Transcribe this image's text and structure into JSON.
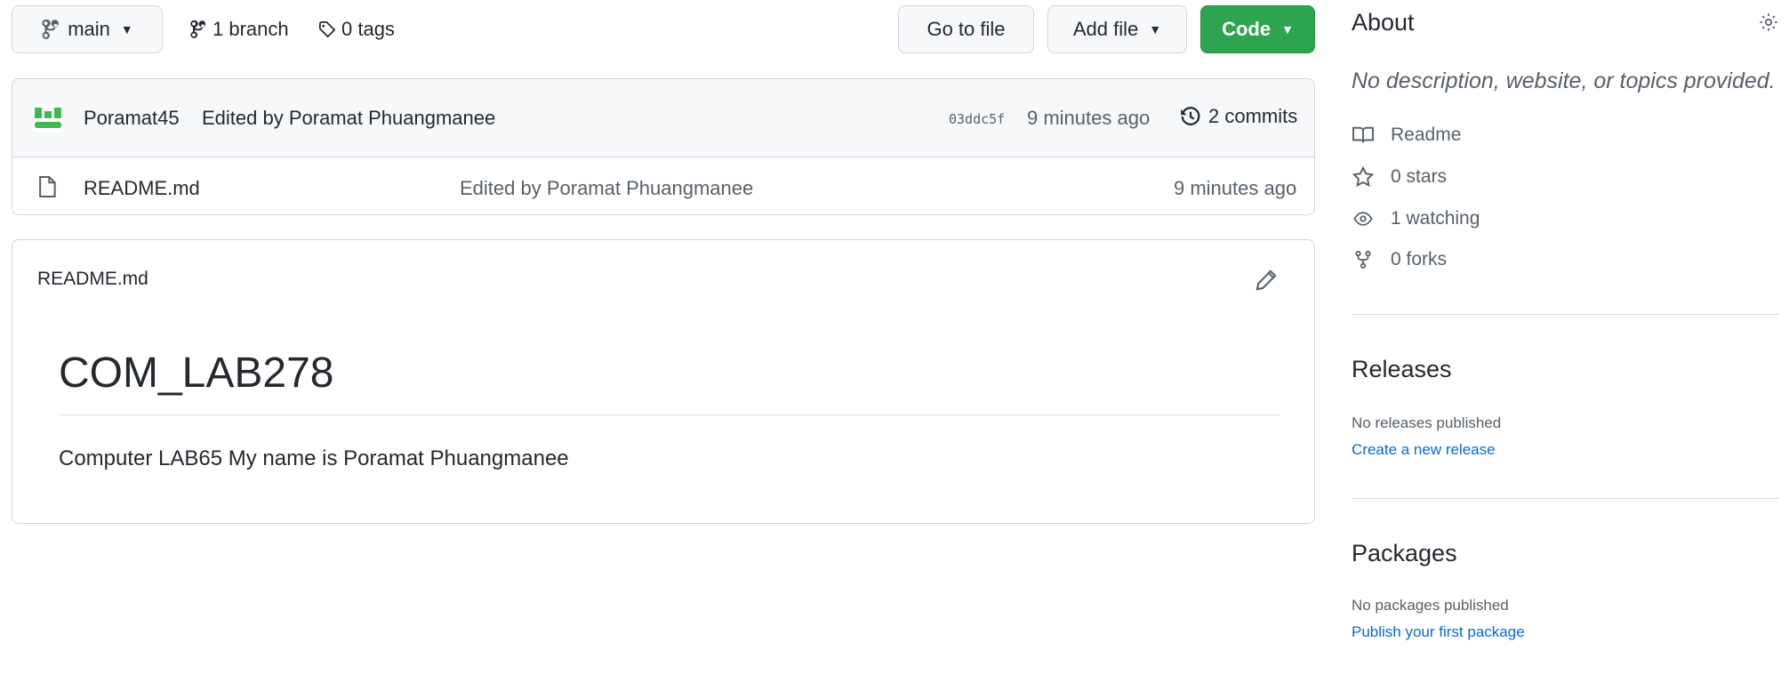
{
  "toolbar": {
    "branch_button": "main",
    "branch_count": "1 branch",
    "tag_count": "0 tags",
    "go_to_file": "Go to file",
    "add_file": "Add file",
    "code": "Code"
  },
  "latest_commit": {
    "author": "Poramat45",
    "message": "Edited by Poramat Phuangmanee",
    "sha": "03ddc5f",
    "time": "9 minutes ago",
    "commits": "2 commits"
  },
  "files": [
    {
      "name": "README.md",
      "message": "Edited by Poramat Phuangmanee",
      "time": "9 minutes ago"
    }
  ],
  "readme": {
    "filename": "README.md",
    "heading": "COM_LAB278",
    "body": "Computer LAB65 My name is Poramat Phuangmanee"
  },
  "sidebar": {
    "about_title": "About",
    "description": "No description, website, or topics provided.",
    "readme": "Readme",
    "stars": "0 stars",
    "watching": "1 watching",
    "forks": "0 forks",
    "releases_title": "Releases",
    "releases_none": "No releases published",
    "releases_link": "Create a new release",
    "packages_title": "Packages",
    "packages_none": "No packages published",
    "packages_link": "Publish your first package"
  },
  "colors": {
    "accent_green": "#2da44e",
    "link_blue": "#0969da",
    "border": "#d0d7de"
  },
  "icons": [
    "branch-icon",
    "tag-icon",
    "avatar-icon",
    "history-icon",
    "file-icon",
    "pencil-icon",
    "gear-icon",
    "book-icon",
    "star-icon",
    "eye-icon",
    "fork-icon"
  ]
}
